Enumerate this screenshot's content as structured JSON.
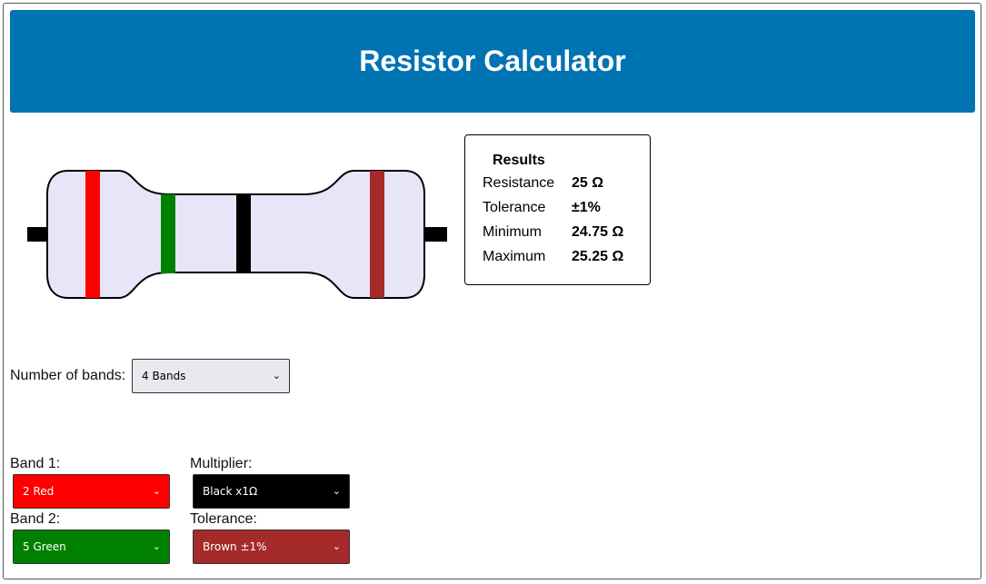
{
  "header": {
    "title": "Resistor Calculator"
  },
  "resistor": {
    "body_color": "#e6e6f8",
    "bands": [
      {
        "name": "band1",
        "color": "#ff0000"
      },
      {
        "name": "band2",
        "color": "#008000"
      },
      {
        "name": "multiplier",
        "color": "#000000"
      },
      {
        "name": "tolerance",
        "color": "#a52a2a"
      }
    ]
  },
  "results": {
    "title": "Results",
    "rows": [
      {
        "label": "Resistance",
        "value": "25 Ω"
      },
      {
        "label": "Tolerance",
        "value": "±1%"
      },
      {
        "label": "Minimum",
        "value": "24.75 Ω"
      },
      {
        "label": "Maximum",
        "value": "25.25 Ω"
      }
    ]
  },
  "number_of_bands": {
    "label": "Number of bands:",
    "selected": "4 Bands"
  },
  "selects": {
    "band1": {
      "label": "Band 1:",
      "selected": "2 Red",
      "color": "#ff0000"
    },
    "band2": {
      "label": "Band 2:",
      "selected": "5 Green",
      "color": "#008000"
    },
    "multiplier": {
      "label": "Multiplier:",
      "selected": "Black x1Ω",
      "color": "#000000"
    },
    "tolerance": {
      "label": "Tolerance:",
      "selected": "Brown ±1%",
      "color": "#a52a2a"
    }
  }
}
